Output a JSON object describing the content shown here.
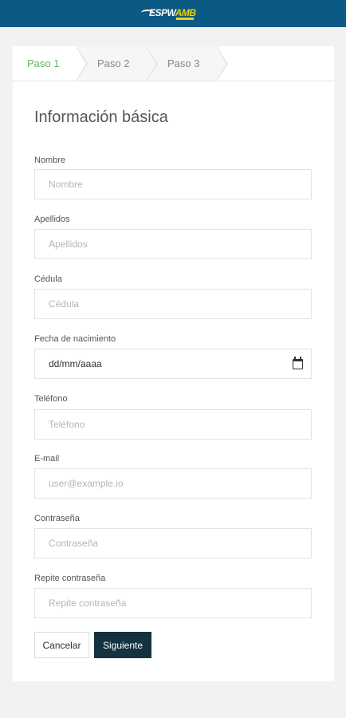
{
  "header": {
    "logo_text_a": "ESPW",
    "logo_text_b": "AMB"
  },
  "steps": [
    {
      "label": "Paso 1",
      "active": true
    },
    {
      "label": "Paso 2",
      "active": false
    },
    {
      "label": "Paso 3",
      "active": false
    }
  ],
  "form": {
    "title": "Información básica",
    "fields": {
      "nombre": {
        "label": "Nombre",
        "placeholder": "Nombre"
      },
      "apellidos": {
        "label": "Apellidos",
        "placeholder": "Apellidos"
      },
      "cedula": {
        "label": "Cédula",
        "placeholder": "Cédula"
      },
      "fecha": {
        "label": "Fecha de nacimiento",
        "value": "dd/mm/aaaa"
      },
      "telefono": {
        "label": "Teléfono",
        "placeholder": "Teléfono"
      },
      "email": {
        "label": "E-mail",
        "placeholder": "user@example.io"
      },
      "contrasena": {
        "label": "Contraseña",
        "placeholder": "Contraseña"
      },
      "repite": {
        "label": "Repite contraseña",
        "placeholder": "Repite contraseña"
      }
    },
    "buttons": {
      "cancel": "Cancelar",
      "next": "Siguiente"
    }
  },
  "colors": {
    "header_bg": "#0b5a86",
    "active_step": "#5cb85c",
    "primary_button": "#12333f"
  }
}
